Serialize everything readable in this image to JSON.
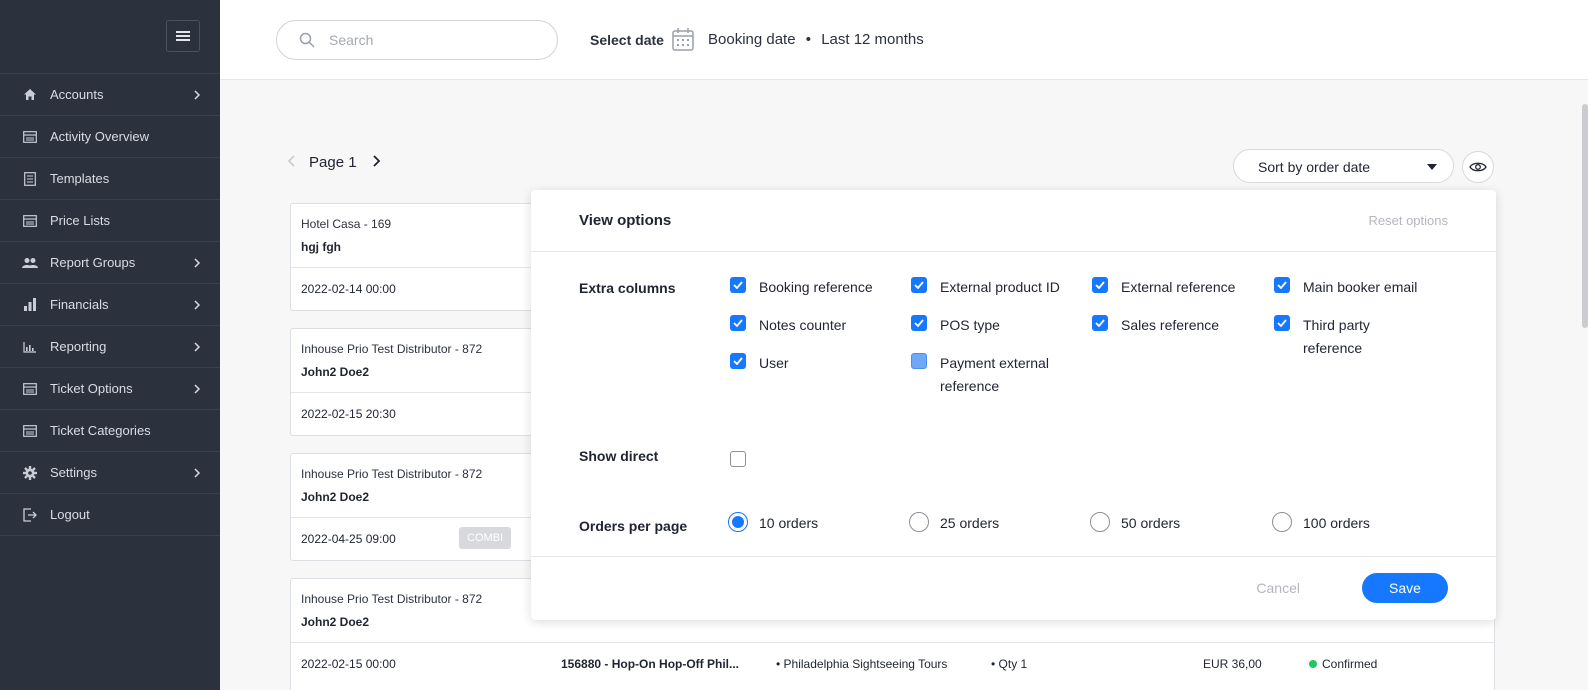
{
  "sidebar": {
    "items": [
      {
        "label": "Accounts",
        "icon": "home-icon",
        "chevron": true
      },
      {
        "label": "Activity Overview",
        "icon": "list-icon",
        "chevron": false
      },
      {
        "label": "Templates",
        "icon": "document-icon",
        "chevron": false
      },
      {
        "label": "Price Lists",
        "icon": "list-icon",
        "chevron": false
      },
      {
        "label": "Report Groups",
        "icon": "users-icon",
        "chevron": true
      },
      {
        "label": "Financials",
        "icon": "bar-chart-icon",
        "chevron": true
      },
      {
        "label": "Reporting",
        "icon": "line-chart-icon",
        "chevron": true
      },
      {
        "label": "Ticket Options",
        "icon": "list-icon",
        "chevron": true
      },
      {
        "label": "Ticket Categories",
        "icon": "list-icon",
        "chevron": false
      },
      {
        "label": "Settings",
        "icon": "gear-icon",
        "chevron": true
      },
      {
        "label": "Logout",
        "icon": "logout-icon",
        "chevron": false
      }
    ]
  },
  "header": {
    "search_placeholder": "Search",
    "select_date": "Select date",
    "date_type": "Booking date",
    "separator": "•",
    "date_range": "Last 12 months"
  },
  "pager": {
    "label": "Page 1"
  },
  "sort": {
    "label": "Sort by order date"
  },
  "orders": [
    {
      "company": "Hotel Casa - 169",
      "name": "hgj fgh",
      "date": "2022-02-14 00:00"
    },
    {
      "company": "Inhouse Prio Test Distributor - 872",
      "name": "John2 Doe2",
      "date": "2022-02-15 20:30"
    },
    {
      "company": "Inhouse Prio Test Distributor - 872",
      "name": "John2 Doe2",
      "date": "2022-04-25 09:00",
      "badge": "COMBI"
    },
    {
      "company": "Inhouse Prio Test Distributor - 872",
      "name": "John2 Doe2",
      "date": "2022-02-15 00:00",
      "ref": "156880 - Hop-On Hop-Off Phil...",
      "product": "• Philadelphia Sightseeing Tours",
      "qty": "• Qty 1",
      "price": "EUR 36,00",
      "status": "Confirmed"
    }
  ],
  "modal": {
    "title": "View options",
    "reset": "Reset options",
    "extra_columns_label": "Extra columns",
    "extra_columns": [
      {
        "label": "Booking reference",
        "state": "on"
      },
      {
        "label": "External product ID",
        "state": "on"
      },
      {
        "label": "External reference",
        "state": "on"
      },
      {
        "label": "Main booker email",
        "state": "on"
      },
      {
        "label": "Notes counter",
        "state": "on"
      },
      {
        "label": "POS type",
        "state": "on"
      },
      {
        "label": "Sales reference",
        "state": "on"
      },
      {
        "label": "Third party reference",
        "state": "on"
      },
      {
        "label": "User",
        "state": "on"
      },
      {
        "label": "Payment external reference",
        "state": "partial"
      }
    ],
    "show_direct_label": "Show direct",
    "show_direct_checked": false,
    "orders_per_page_label": "Orders per page",
    "orders_per_page": [
      {
        "label": "10 orders",
        "selected": true
      },
      {
        "label": "25 orders",
        "selected": false
      },
      {
        "label": "50 orders",
        "selected": false
      },
      {
        "label": "100 orders",
        "selected": false
      }
    ],
    "cancel": "Cancel",
    "save": "Save"
  },
  "colors": {
    "sidebar": "#2b313d",
    "accent": "#1677ff",
    "status_confirmed": "#22c55e"
  }
}
